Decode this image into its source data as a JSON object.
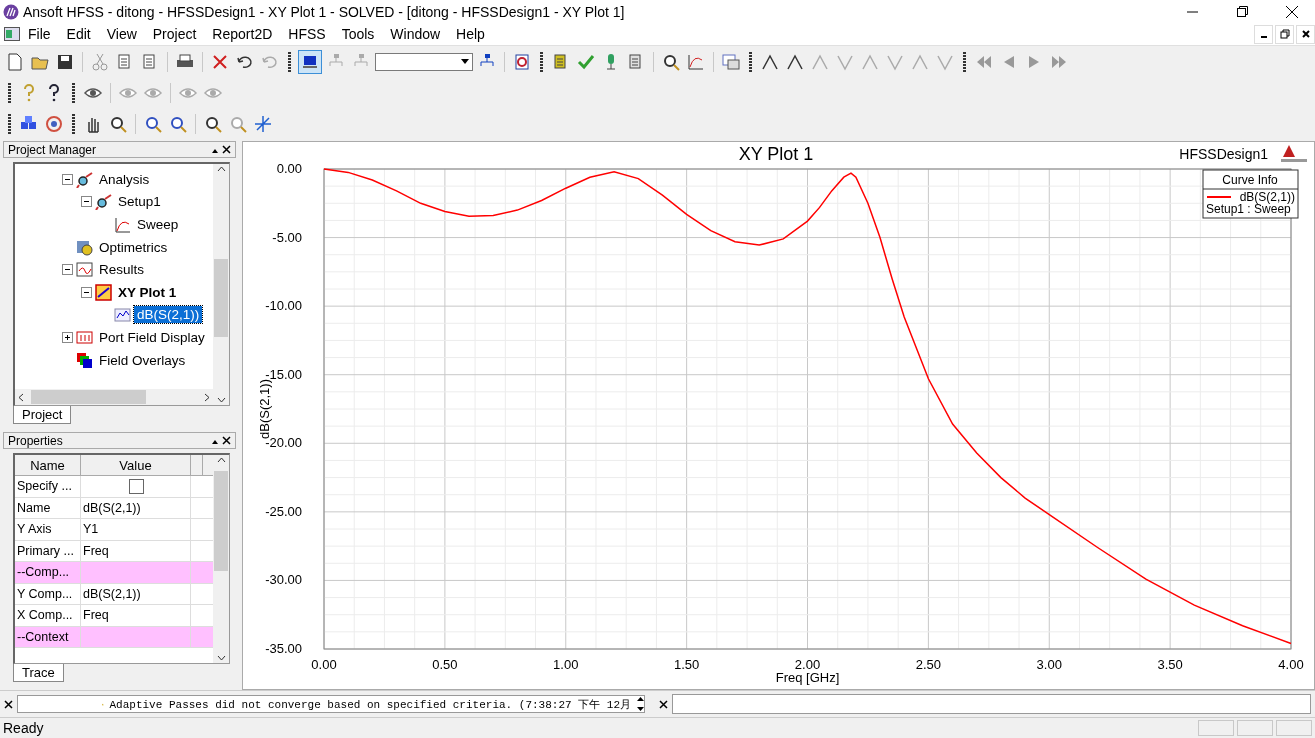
{
  "window": {
    "title": "Ansoft HFSS  - ditong - HFSSDesign1 - XY Plot 1 - SOLVED - [ditong - HFSSDesign1 - XY Plot 1]"
  },
  "menu": [
    "File",
    "Edit",
    "View",
    "Project",
    "Report2D",
    "HFSS",
    "Tools",
    "Window",
    "Help"
  ],
  "project_manager": {
    "title": "Project Manager",
    "tab": "Project",
    "tree": [
      {
        "label": "Analysis",
        "kind": "analysis",
        "expanded": true,
        "selected": false,
        "children": [
          {
            "label": "Setup1",
            "kind": "analysis",
            "expanded": true,
            "selected": false,
            "children": [
              {
                "label": "Sweep",
                "kind": "sweep",
                "selected": false
              }
            ]
          }
        ]
      },
      {
        "label": "Optimetrics",
        "kind": "optimetrics",
        "selected": false
      },
      {
        "label": "Results",
        "kind": "results",
        "expanded": true,
        "selected": false,
        "children": [
          {
            "label": "XY Plot 1",
            "kind": "plot",
            "bold": true,
            "expanded": true,
            "selected": false,
            "children": [
              {
                "label": "dB(S(2,1))",
                "kind": "trace",
                "selected": true
              }
            ]
          }
        ]
      },
      {
        "label": "Port Field Display",
        "kind": "port",
        "expanded": false,
        "selected": false
      },
      {
        "label": "Field Overlays",
        "kind": "overlays",
        "selected": false
      }
    ]
  },
  "properties": {
    "title": "Properties",
    "tab": "Trace",
    "columns": [
      "Name",
      "Value"
    ],
    "rows": [
      {
        "kind": "checkbox",
        "name": "Specify ...",
        "checked": false
      },
      {
        "kind": "value",
        "name": "Name",
        "value": "dB(S(2,1))"
      },
      {
        "kind": "value",
        "name": "Y Axis",
        "value": "Y1"
      },
      {
        "kind": "value",
        "name": "Primary ...",
        "value": "Freq"
      },
      {
        "kind": "section",
        "name": "--Comp..."
      },
      {
        "kind": "value",
        "name": "Y Comp...",
        "value": "dB(S(2,1))"
      },
      {
        "kind": "value",
        "name": "X Comp...",
        "value": "Freq"
      },
      {
        "kind": "section",
        "name": "--Context"
      }
    ]
  },
  "plot": {
    "title": "XY Plot 1",
    "design": "HFSSDesign1",
    "legend": {
      "title": "Curve Info",
      "sub": "Setup1 : Sweep"
    },
    "chart_data": {
      "type": "line",
      "xlabel": "Freq [GHz]",
      "ylabel": "dB(S(2,1))",
      "grid": true,
      "x": [
        0,
        0.1,
        0.2,
        0.3,
        0.4,
        0.5,
        0.6,
        0.7,
        0.8,
        0.9,
        1.0,
        1.1,
        1.2,
        1.3,
        1.4,
        1.5,
        1.6,
        1.7,
        1.8,
        1.9,
        2.0,
        2.05,
        2.1,
        2.15,
        2.18,
        2.2,
        2.25,
        2.3,
        2.35,
        2.4,
        2.5,
        2.6,
        2.7,
        2.8,
        2.9,
        3.0,
        3.2,
        3.4,
        3.6,
        3.8,
        4.0
      ],
      "series": [
        {
          "name": "dB(S(2,1))",
          "color": "#ff0000",
          "values": [
            0,
            -0.25,
            -0.8,
            -1.6,
            -2.5,
            -3.1,
            -3.45,
            -3.4,
            -3.0,
            -2.3,
            -1.4,
            -0.6,
            -0.2,
            -0.7,
            -1.9,
            -3.3,
            -4.5,
            -5.3,
            -5.55,
            -5.1,
            -3.8,
            -2.8,
            -1.6,
            -0.6,
            -0.3,
            -0.6,
            -2.5,
            -5.0,
            -8.0,
            -10.8,
            -15.3,
            -18.6,
            -20.7,
            -22.5,
            -24.0,
            -25.2,
            -27.6,
            -29.9,
            -31.8,
            -33.3,
            -34.6
          ]
        }
      ],
      "xlim": [
        0,
        4
      ],
      "ylim": [
        -35,
        0
      ],
      "xticks": [
        {
          "value": 0,
          "label": "0.00"
        },
        {
          "value": 0.5,
          "label": "0.50"
        },
        {
          "value": 1,
          "label": "1.00"
        },
        {
          "value": 1.5,
          "label": "1.50"
        },
        {
          "value": 2,
          "label": "2.00"
        },
        {
          "value": 2.5,
          "label": "2.50"
        },
        {
          "value": 3,
          "label": "3.00"
        },
        {
          "value": 3.5,
          "label": "3.50"
        },
        {
          "value": 4,
          "label": "4.00"
        }
      ],
      "yticks": [
        {
          "value": 0,
          "label": "0.00"
        },
        {
          "value": -5,
          "label": "-5.00"
        },
        {
          "value": -10,
          "label": "-10.00"
        },
        {
          "value": -15,
          "label": "-15.00"
        },
        {
          "value": -20,
          "label": "-20.00"
        },
        {
          "value": -25,
          "label": "-25.00"
        },
        {
          "value": -30,
          "label": "-30.00"
        },
        {
          "value": -35,
          "label": "-35.00"
        }
      ]
    }
  },
  "message": {
    "text": "Adaptive Passes did not converge based on specified criteria. (7:38:27 下午  12月"
  },
  "status_bar": {
    "text": "Ready"
  }
}
